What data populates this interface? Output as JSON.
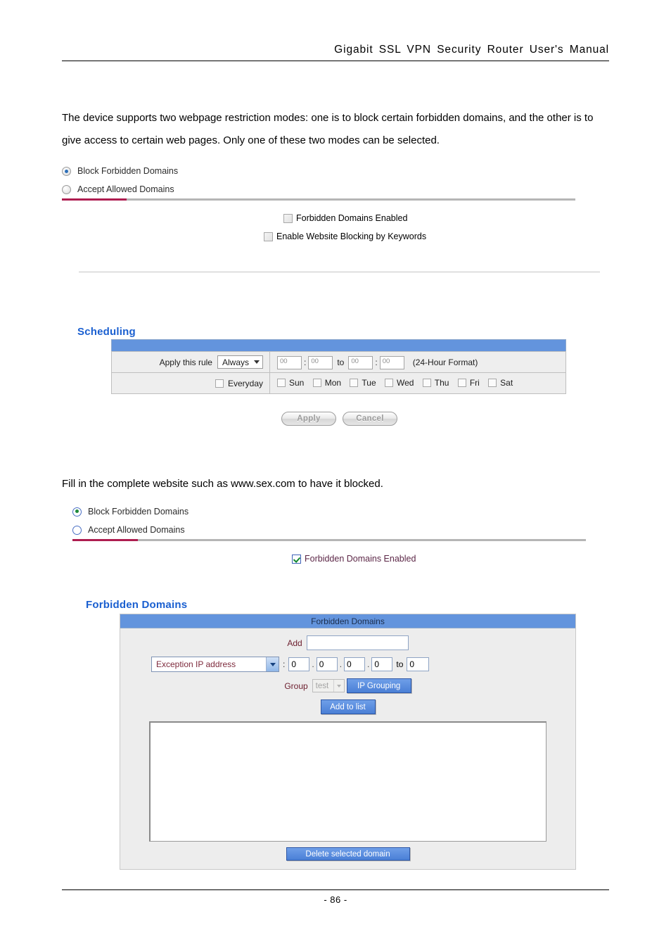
{
  "header": {
    "manual_title": "Gigabit  SSL  VPN  Security  Router  User's  Manual"
  },
  "intro_paragraph": "The device supports two webpage restriction modes: one is to block certain forbidden domains, and the other is to give access to certain web pages. Only one of these two modes can be selected.",
  "mode_selector_top": {
    "options": [
      {
        "label": "Block Forbidden Domains",
        "selected": true
      },
      {
        "label": "Accept Allowed Domains",
        "selected": false
      }
    ]
  },
  "checkboxes_top": [
    {
      "label": "Forbidden Domains Enabled",
      "checked": false
    },
    {
      "label": "Enable Website Blocking by Keywords",
      "checked": false
    }
  ],
  "scheduling": {
    "title": "Scheduling",
    "apply_rule_label": "Apply this rule",
    "apply_rule_value": "Always",
    "time_from_hour": "00",
    "time_from_min": "00",
    "time_to_word": "to",
    "time_to_hour": "00",
    "time_to_min": "00",
    "format_note": "(24-Hour Format)",
    "everyday_label": "Everyday",
    "days": [
      "Sun",
      "Mon",
      "Tue",
      "Wed",
      "Thu",
      "Fri",
      "Sat"
    ]
  },
  "action_buttons": {
    "apply": "Apply",
    "cancel": "Cancel"
  },
  "fill_paragraph": "Fill in the complete website such as www.sex.com to have it blocked.",
  "mode_selector_bottom": {
    "options": [
      {
        "label": "Block Forbidden Domains",
        "selected": true
      },
      {
        "label": "Accept Allowed Domains",
        "selected": false
      }
    ]
  },
  "checkbox_bottom": {
    "label": "Forbidden Domains Enabled",
    "checked": true
  },
  "forbidden_domains": {
    "section_title": "Forbidden Domains",
    "panel_header": "Forbidden Domains",
    "add_label": "Add",
    "add_value": "",
    "exception_select_value": "Exception IP address",
    "colon": ":",
    "ip_octets": [
      "0",
      "0",
      "0",
      "0"
    ],
    "range_word": "to",
    "ip_range_end": "0",
    "group_label": "Group",
    "group_select_value": "test",
    "ip_grouping_button": "IP Grouping",
    "add_to_list_button": "Add to list",
    "domain_list": [],
    "delete_button": "Delete selected domain"
  },
  "footer": {
    "page_number": "- 86 -"
  },
  "colors": {
    "accent_blue": "#1a5fd0",
    "table_header_blue": "#6394dd",
    "rule_magenta": "#ae1d50",
    "button_blue": "#4a7fd6",
    "check_green": "#12892f"
  }
}
